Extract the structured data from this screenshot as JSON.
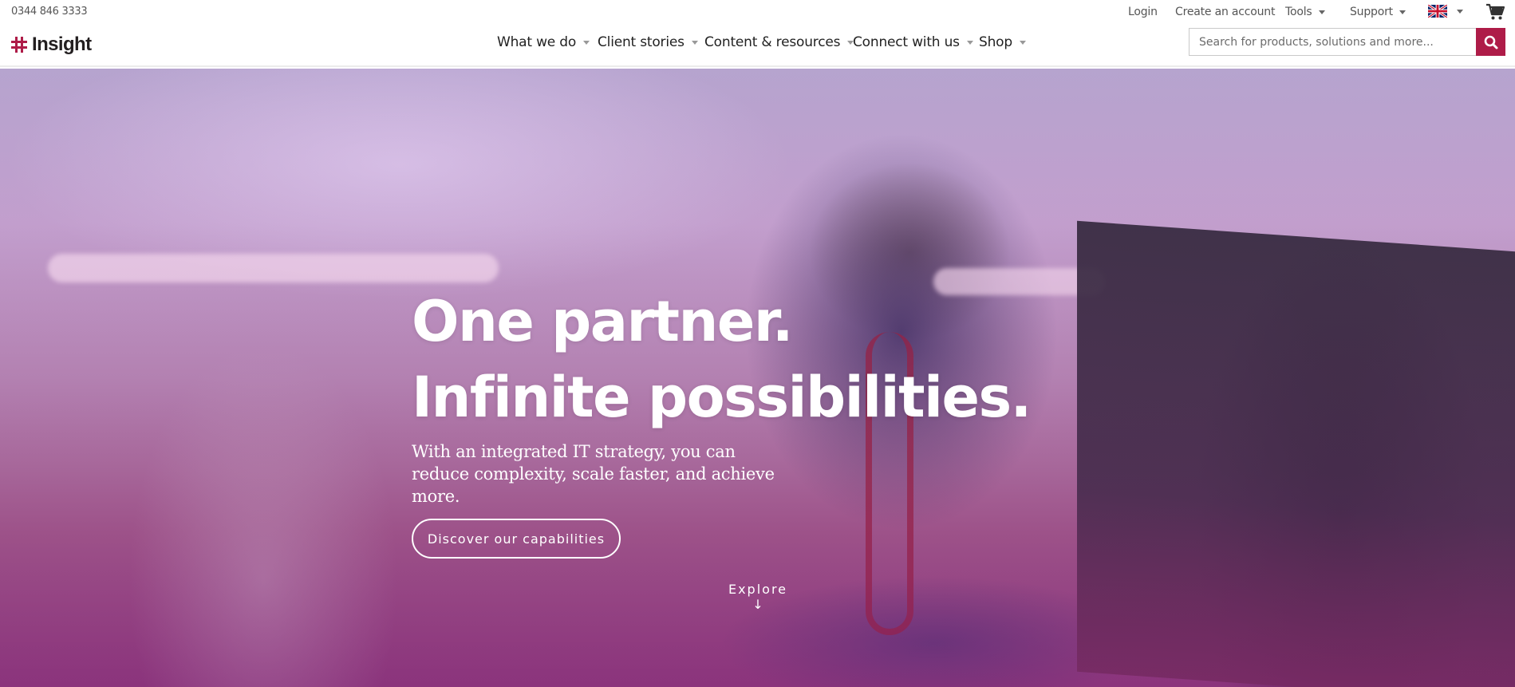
{
  "utility": {
    "phone": "0344 846 3333",
    "login": "Login",
    "create_account": "Create an account",
    "tools": "Tools",
    "support": "Support"
  },
  "nav": {
    "logo_text": "Insight",
    "items": [
      {
        "label": "What we do"
      },
      {
        "label": "Client stories"
      },
      {
        "label": "Content & resources"
      },
      {
        "label": "Connect with us"
      },
      {
        "label": "Shop"
      }
    ]
  },
  "search": {
    "placeholder": "Search for products, solutions and more..."
  },
  "hero": {
    "headline_line1": "One partner.",
    "headline_line2": "Infinite possibilities.",
    "subhead": "With an integrated IT strategy, you can reduce complexity, scale faster, and achieve more.",
    "cta": "Discover our capabilities",
    "explore": "Explore",
    "explore_arrow": "↓"
  },
  "colors": {
    "brand": "#ae1c48",
    "hero_overlay": "#a05a8c"
  },
  "icons": {
    "search": "search-icon",
    "cart": "cart-icon",
    "flag": "uk-flag-icon",
    "logo": "insight-logo-icon"
  }
}
